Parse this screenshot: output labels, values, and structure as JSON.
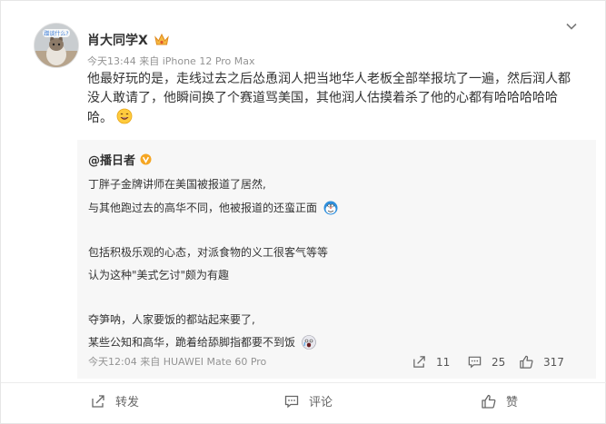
{
  "post": {
    "username": "肖大同学X",
    "time": "今天13:44",
    "source": "来自 iPhone 12 Pro Max",
    "avatar_caption": "蹭谈什么?",
    "lines": [
      "他最好玩的是，走线过去之后怂恿润人把当地华人老板全部举报坑了一遍，然后润人都",
      "没人敢请了，他瞬间换了个赛道骂美国，其他润人估摸着杀了他的心都有哈哈哈哈哈",
      "哈。"
    ]
  },
  "repost": {
    "username": "@播日者",
    "lines": [
      "丁胖子金牌讲师在美国被报道了居然,",
      "与其他跑过去的高华不同，他被报道的还蛮正面",
      "包括积极乐观的心态，对派食物的义工很客气等等",
      "认为这种\"美式乞讨\"颇为有趣",
      "夺笋呐，人家要饭的都站起来要了,",
      "某些公知和高华，跪着给舔脚指都要不到饭"
    ],
    "time": "今天12:04",
    "source": "来自 HUAWEI Mate 60 Pro",
    "reposts": "11",
    "comments": "25",
    "likes": "317"
  },
  "actions": {
    "repost_label": "转发",
    "comment_label": "评论",
    "like_label": "赞"
  },
  "icons": {
    "menu": "chevron-down-icon",
    "vip": "crown-icon",
    "verified": "orange-v-badge-icon",
    "repost": "share-arrow-icon",
    "comment": "comment-bubble-icon",
    "like": "thumb-up-icon"
  },
  "colors": {
    "text": "#333333",
    "meta": "#939393",
    "repost_bg": "#f7f7f7",
    "badge_orange": "#f5a623"
  }
}
